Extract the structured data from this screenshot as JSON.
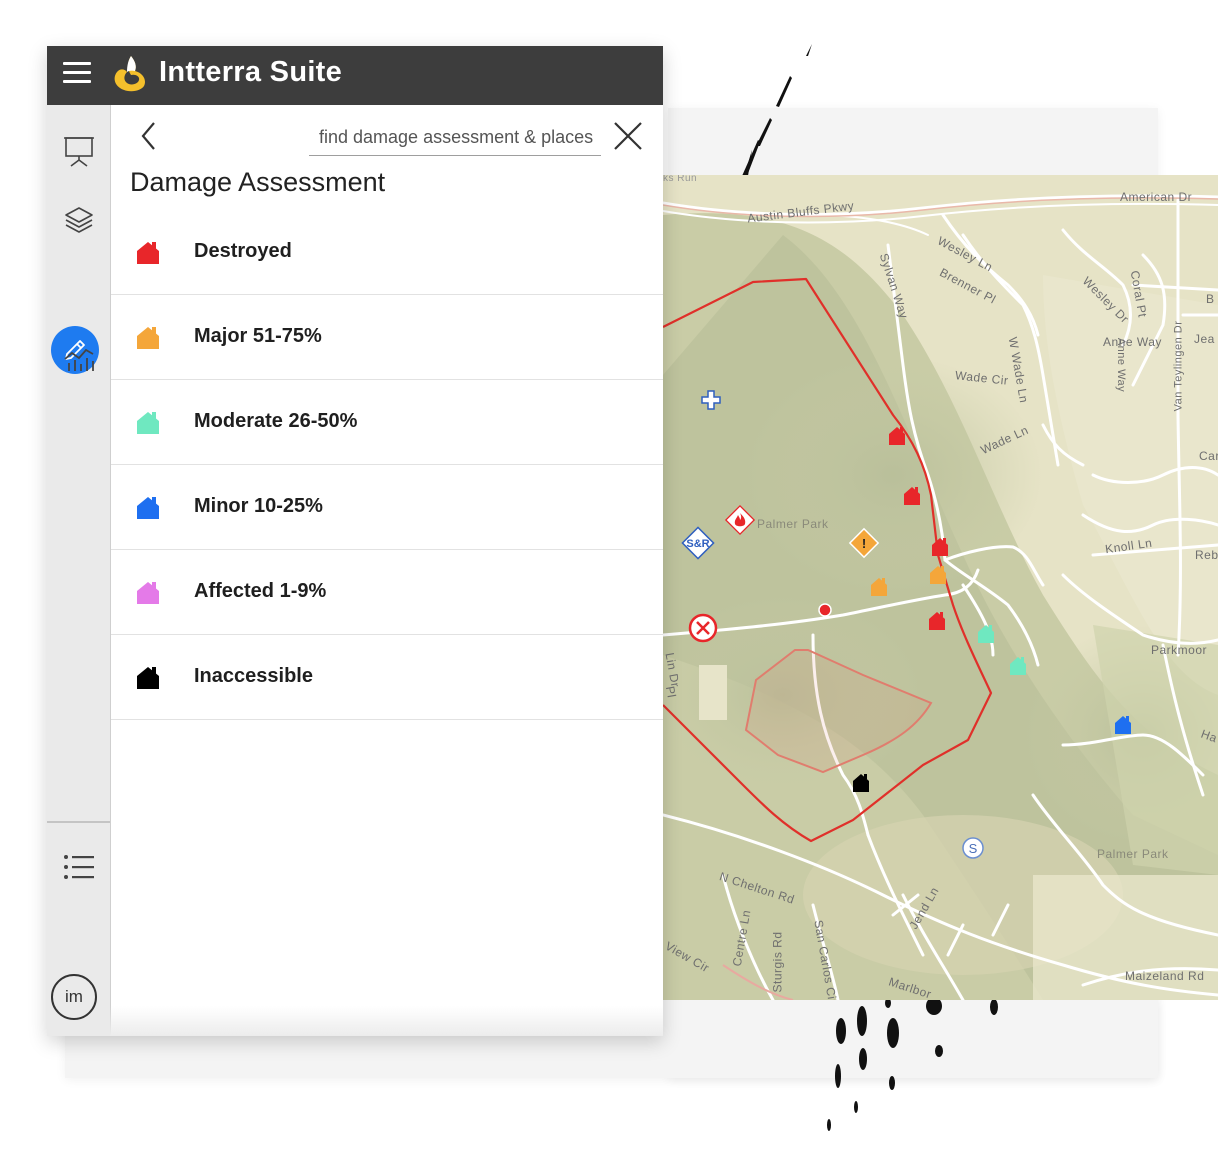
{
  "app": {
    "title": "Intterra Suite",
    "menu_icon": "hamburger-menu-icon",
    "logo": "intterra-logo-icon",
    "brand_colors": {
      "topbar": "#3d3d3d",
      "logo_yellow": "#f5c02c",
      "accent_blue": "#1e7bf0"
    }
  },
  "sidebar": {
    "items": [
      {
        "icon": "presentation-board-icon"
      },
      {
        "icon": "layers-icon"
      },
      {
        "icon": "pencil-icon",
        "active": true
      },
      {
        "icon": "analytics-chart-icon"
      },
      {
        "icon": "list-icon"
      }
    ],
    "avatar": {
      "initials": "im"
    }
  },
  "panel": {
    "back_icon": "chevron-left-icon",
    "search": {
      "value": "",
      "placeholder": "find damage assessment & places"
    },
    "close_icon": "close-icon",
    "title": "Damage Assessment",
    "categories": [
      {
        "label": "Destroyed",
        "color": "#e8262a",
        "icon": "house-icon"
      },
      {
        "label": "Major 51-75%",
        "color": "#f4a63a",
        "icon": "house-icon"
      },
      {
        "label": "Moderate 26-50%",
        "color": "#6fe8c0",
        "icon": "house-icon"
      },
      {
        "label": "Minor 10-25%",
        "color": "#1e6ff0",
        "icon": "house-icon"
      },
      {
        "label": "Affected 1-9%",
        "color": "#e47ae8",
        "icon": "house-icon"
      },
      {
        "label": "Inaccessible",
        "color": "#000000",
        "icon": "house-icon"
      }
    ]
  },
  "map": {
    "streets": [
      "American Dr",
      "Austin Bluffs Pkwy",
      "Wesley Ln",
      "Brenner Pl",
      "Sylvan Way",
      "Coral Pt",
      "Wesley Dr",
      "Anne Way",
      "Van Teylingen Dr",
      "Jea",
      "Wade Cir",
      "W Wade Ln",
      "Wade Ln",
      "Care",
      "Knoll Ln",
      "Reb",
      "Parkmoor",
      "Ha",
      "N Chelton Rd",
      "Jend Ln",
      "Centre Ln",
      "Sturgis Rd",
      "San Carlos Cir",
      "Marlbor",
      "Maizeland Rd",
      "B",
      "View Cir",
      "Lin Dr",
      "Pl",
      "ks Run"
    ],
    "places": [
      "Palmer Park",
      "Palmer Park"
    ],
    "markers": [
      {
        "type": "destroyed",
        "color": "#e8262a",
        "count": 5
      },
      {
        "type": "major",
        "color": "#f4a63a",
        "count": 2
      },
      {
        "type": "moderate",
        "color": "#6fe8c0",
        "count": 2
      },
      {
        "type": "minor",
        "color": "#1e6ff0",
        "count": 1
      },
      {
        "type": "inaccessible",
        "color": "#000000",
        "count": 1
      }
    ],
    "symbols": {
      "search_rescue": "S&R",
      "hazard": "!",
      "staging": "S"
    },
    "perimeter_color": "#e0302a"
  }
}
